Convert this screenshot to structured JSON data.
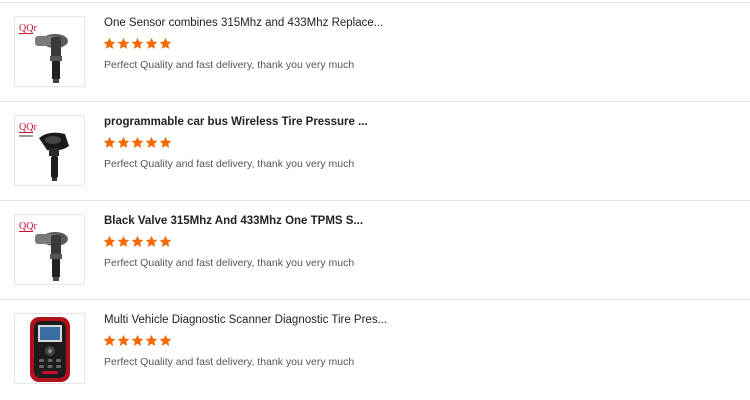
{
  "reviews": [
    {
      "title": "One Sensor combines 315Mhz and 433Mhz Replace...",
      "rating": 5,
      "comment": "Perfect Quality and fast delivery, thank you very much",
      "brand": "QQr",
      "product_icon": "tpms-sensor-icon"
    },
    {
      "title": "programmable car bus Wireless Tire Pressure ...",
      "rating": 5,
      "comment": "Perfect Quality and fast delivery, thank you very much",
      "brand": "QQr",
      "product_icon": "tpms-sensor-icon"
    },
    {
      "title": "Black Valve 315Mhz And 433Mhz One TPMS S...",
      "rating": 5,
      "comment": "Perfect Quality and fast delivery, thank you very much",
      "brand": "QQr",
      "product_icon": "tpms-sensor-icon"
    },
    {
      "title": "Multi Vehicle Diagnostic Scanner Diagnostic Tire Pres...",
      "rating": 5,
      "comment": "Perfect Quality and fast delivery, thank you very much",
      "brand": "",
      "product_icon": "diagnostic-scanner-icon"
    }
  ],
  "colors": {
    "star": "#f56a00",
    "brand": "#c8102e"
  }
}
